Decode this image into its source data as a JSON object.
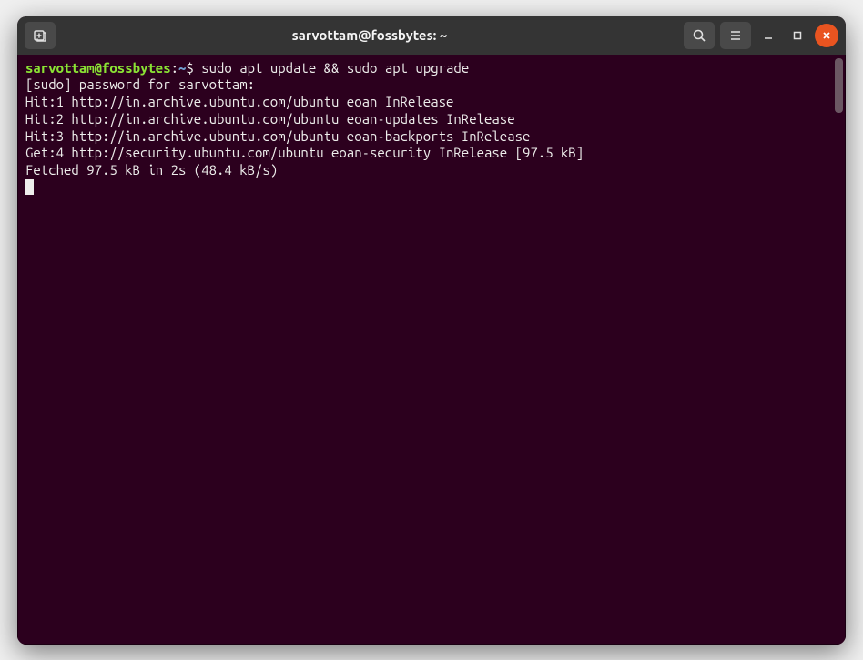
{
  "titlebar": {
    "title": "sarvottam@fossbytes: ~",
    "icons": {
      "new_tab": "new-tab-icon",
      "search": "search-icon",
      "menu": "hamburger-icon",
      "minimize": "minimize-icon",
      "maximize": "maximize-icon",
      "close": "close-icon"
    }
  },
  "prompt": {
    "user_host": "sarvottam@fossbytes",
    "sep1": ":",
    "path": "~",
    "sigil": "$ "
  },
  "command": "sudo apt update && sudo apt upgrade",
  "output": {
    "line1": "[sudo] password for sarvottam:",
    "line2": "Hit:1 http://in.archive.ubuntu.com/ubuntu eoan InRelease",
    "line3": "Hit:2 http://in.archive.ubuntu.com/ubuntu eoan-updates InRelease",
    "line4": "Hit:3 http://in.archive.ubuntu.com/ubuntu eoan-backports InRelease",
    "line5": "Get:4 http://security.ubuntu.com/ubuntu eoan-security InRelease [97.5 kB]",
    "line6": "Fetched 97.5 kB in 2s (48.4 kB/s)"
  }
}
